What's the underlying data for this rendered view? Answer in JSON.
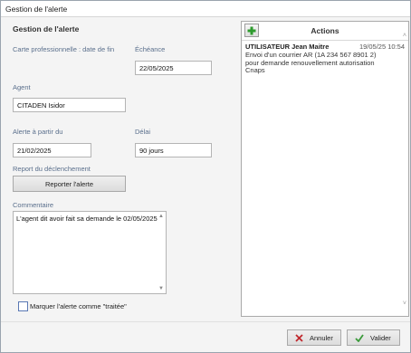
{
  "window": {
    "title": "Gestion de l'alerte"
  },
  "form": {
    "section_title": "Gestion de l'alerte",
    "carte_label": "Carte professionnelle : date de fin",
    "echeance_label": "Échéance",
    "echeance_value": "22/05/2025",
    "agent_label": "Agent",
    "agent_value": "CITADEN Isidor",
    "alerte_label": "Alerte à partir du",
    "alerte_value": "21/02/2025",
    "delai_label": "Délai",
    "delai_value": "90 jours",
    "report_label": "Report du déclenchement",
    "report_button": "Reporter l'alerte",
    "commentaire_label": "Commentaire",
    "commentaire_value": "L'agent dit avoir fait sa demande le 02/05/2025",
    "treated_label": "Marquer l'alerte comme \"traitée\""
  },
  "actions": {
    "title": "Actions",
    "add_icon": "plus-icon",
    "entries": [
      {
        "user": "UTILISATEUR Jean Maitre",
        "datetime": "19/05/25 10:54",
        "description": "Envoi d'un courrier AR (1A 234 567 8901 2) pour demande renouvellement autorisation Cnaps"
      }
    ]
  },
  "footer": {
    "cancel_label": "Annuler",
    "validate_label": "Valider"
  },
  "colors": {
    "label_blue": "#5a6f8c",
    "add_green": "#2e9b2e",
    "cancel_red": "#c0282d",
    "validate_green": "#3a9a3a"
  }
}
